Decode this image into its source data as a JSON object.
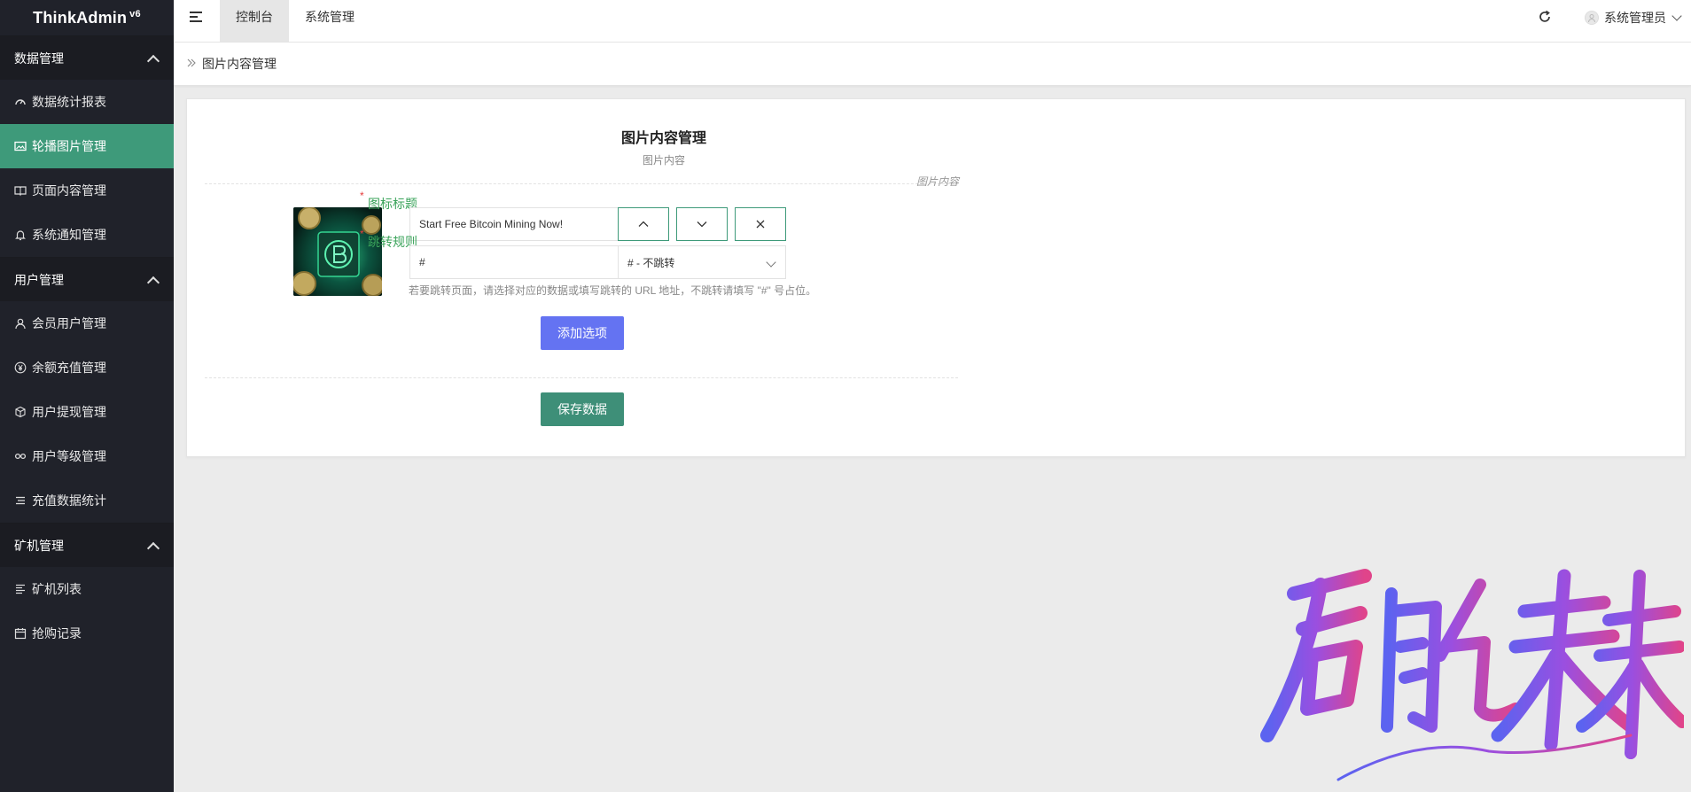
{
  "app": {
    "name": "ThinkAdmin",
    "version": "v6"
  },
  "sidebar": {
    "groups": [
      {
        "title": "数据管理",
        "items": [
          {
            "label": "数据统计报表",
            "icon": "dashboard-icon"
          },
          {
            "label": "轮播图片管理",
            "icon": "image-icon",
            "active": true
          },
          {
            "label": "页面内容管理",
            "icon": "book-icon"
          },
          {
            "label": "系统通知管理",
            "icon": "bell-icon"
          }
        ]
      },
      {
        "title": "用户管理",
        "items": [
          {
            "label": "会员用户管理",
            "icon": "user-icon"
          },
          {
            "label": "余额充值管理",
            "icon": "yen-icon"
          },
          {
            "label": "用户提现管理",
            "icon": "cube-icon"
          },
          {
            "label": "用户等级管理",
            "icon": "link-icon"
          },
          {
            "label": "充值数据统计",
            "icon": "list-icon"
          }
        ]
      },
      {
        "title": "矿机管理",
        "items": [
          {
            "label": "矿机列表",
            "icon": "align-left-icon"
          },
          {
            "label": "抢购记录",
            "icon": "calendar-icon"
          }
        ]
      }
    ]
  },
  "header": {
    "tabs": [
      {
        "label": "控制台"
      },
      {
        "label": "系统管理"
      }
    ],
    "user": "系统管理员"
  },
  "breadcrumb": {
    "title": "图片内容管理"
  },
  "form": {
    "title": "图片内容管理",
    "subtitle": "图片内容",
    "section_label": "图片内容",
    "title_label": "图标标题",
    "title_value": "Start Free Bitcoin Mining Now!",
    "rule_label": "跳转规则",
    "rule_value": "#",
    "rule_select": "# - 不跳转",
    "help": "若要跳转页面，请选择对应的数据或填写跳转的 URL 地址，不跳转请填写 \"#\" 号占位。",
    "add_label": "添加选项",
    "save_label": "保存数据"
  },
  "colors": {
    "accent": "#3e9a7a",
    "sidebar": "#20222a",
    "add_button": "#6473f2",
    "required": "#e53c3c"
  }
}
